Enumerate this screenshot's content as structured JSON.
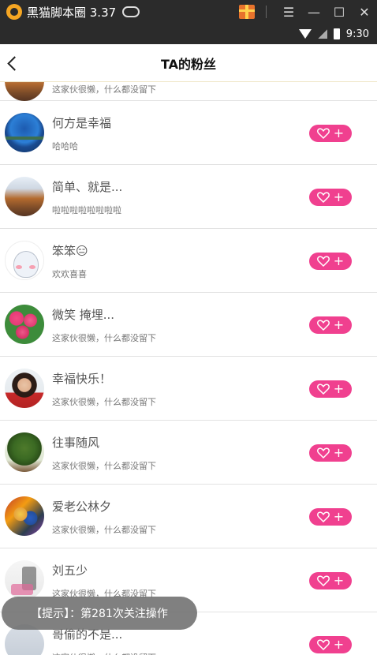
{
  "emulator": {
    "title": "黑猫脚本圈 3.37",
    "icons": [
      "app-logo-icon",
      "gamepad-icon",
      "gift-icon",
      "menu-icon",
      "minimize-icon",
      "maximize-icon",
      "close-icon"
    ],
    "menu_glyph": "☰",
    "minimize_glyph": "—",
    "maximize_glyph": "☐",
    "close_glyph": "✕"
  },
  "status_bar": {
    "time": "9:30",
    "icons": [
      "wifi-icon",
      "signal-icon",
      "battery-icon"
    ]
  },
  "header": {
    "title": "TA的粉丝",
    "back_icon": "chevron-left-icon"
  },
  "partial_row": {
    "bio": "这家伙很懒，什么都没留下"
  },
  "fans": [
    {
      "name": "何方是幸福",
      "bio": "哈哈哈",
      "avatar": "sea"
    },
    {
      "name": "简单、就是...",
      "bio": "啦啦啦啦啦啦啦啦",
      "avatar": "mountain"
    },
    {
      "name": "笨笨😑",
      "bio": "欢欢喜喜",
      "avatar": "cartoon"
    },
    {
      "name": "微笑  掩埋...",
      "bio": "这家伙很懒，什么都没留下",
      "avatar": "rose"
    },
    {
      "name": "幸福快乐！",
      "bio": "这家伙很懒，什么都没留下",
      "avatar": "woman"
    },
    {
      "name": "往事随风",
      "bio": "这家伙很懒，什么都没留下",
      "avatar": "tree"
    },
    {
      "name": "爱老公林夕",
      "bio": "这家伙很懒，什么都没留下",
      "avatar": "comic"
    },
    {
      "name": "刘五少",
      "bio": "这家伙很懒，什么都没留下",
      "avatar": "text"
    },
    {
      "name": "哥偷的不是...",
      "bio": "这家伙很懒，什么都没留下",
      "avatar": "grey"
    }
  ],
  "follow_button": {
    "icon": "heart-outline-icon",
    "plus": "+",
    "color": "#f0408f"
  },
  "toast": {
    "text": "【提示】：第281次关注操作"
  },
  "colors": {
    "accent": "#f0408f",
    "chrome": "#2b2b2b",
    "divider": "#e2e2e2"
  }
}
